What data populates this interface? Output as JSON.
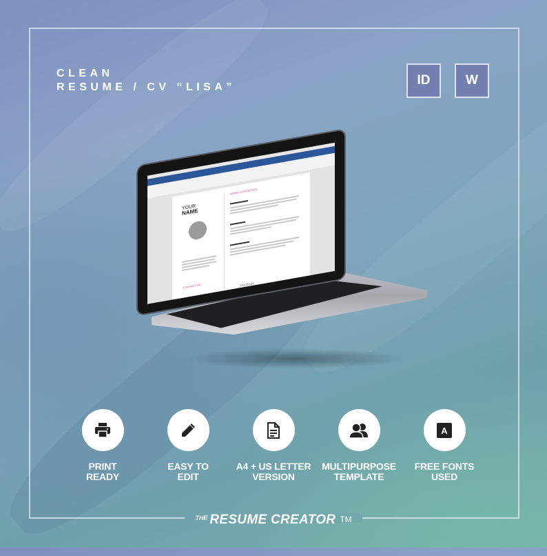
{
  "header": {
    "title_line1": "CLEAN",
    "title_line2": "RESUME / CV “LISA”",
    "badges": [
      {
        "label": "ID",
        "meaning": "InDesign"
      },
      {
        "label": "W",
        "meaning": "Word"
      }
    ]
  },
  "mockup": {
    "device": "MacBook",
    "brand_label": "MacBook",
    "document": {
      "name_line1": "YOUR",
      "name_line2": "NAME",
      "section_work": "WORK EXPERIENCE",
      "section_contact": "CONTACT ME"
    }
  },
  "features": [
    {
      "icon": "printer-icon",
      "label": "PRINT\nREADY"
    },
    {
      "icon": "pencil-icon",
      "label": "EASY TO\nEDIT"
    },
    {
      "icon": "document-icon",
      "label": "A4 + US LETTER\nVERSION"
    },
    {
      "icon": "users-icon",
      "label": "MULTIPURPOSE\nTEMPLATE"
    },
    {
      "icon": "font-icon",
      "label": "FREE FONTS\nUSED"
    }
  ],
  "footer": {
    "brand_prefix": "THE",
    "brand_name": "RESUME CREATOR",
    "trademark": "TM"
  }
}
